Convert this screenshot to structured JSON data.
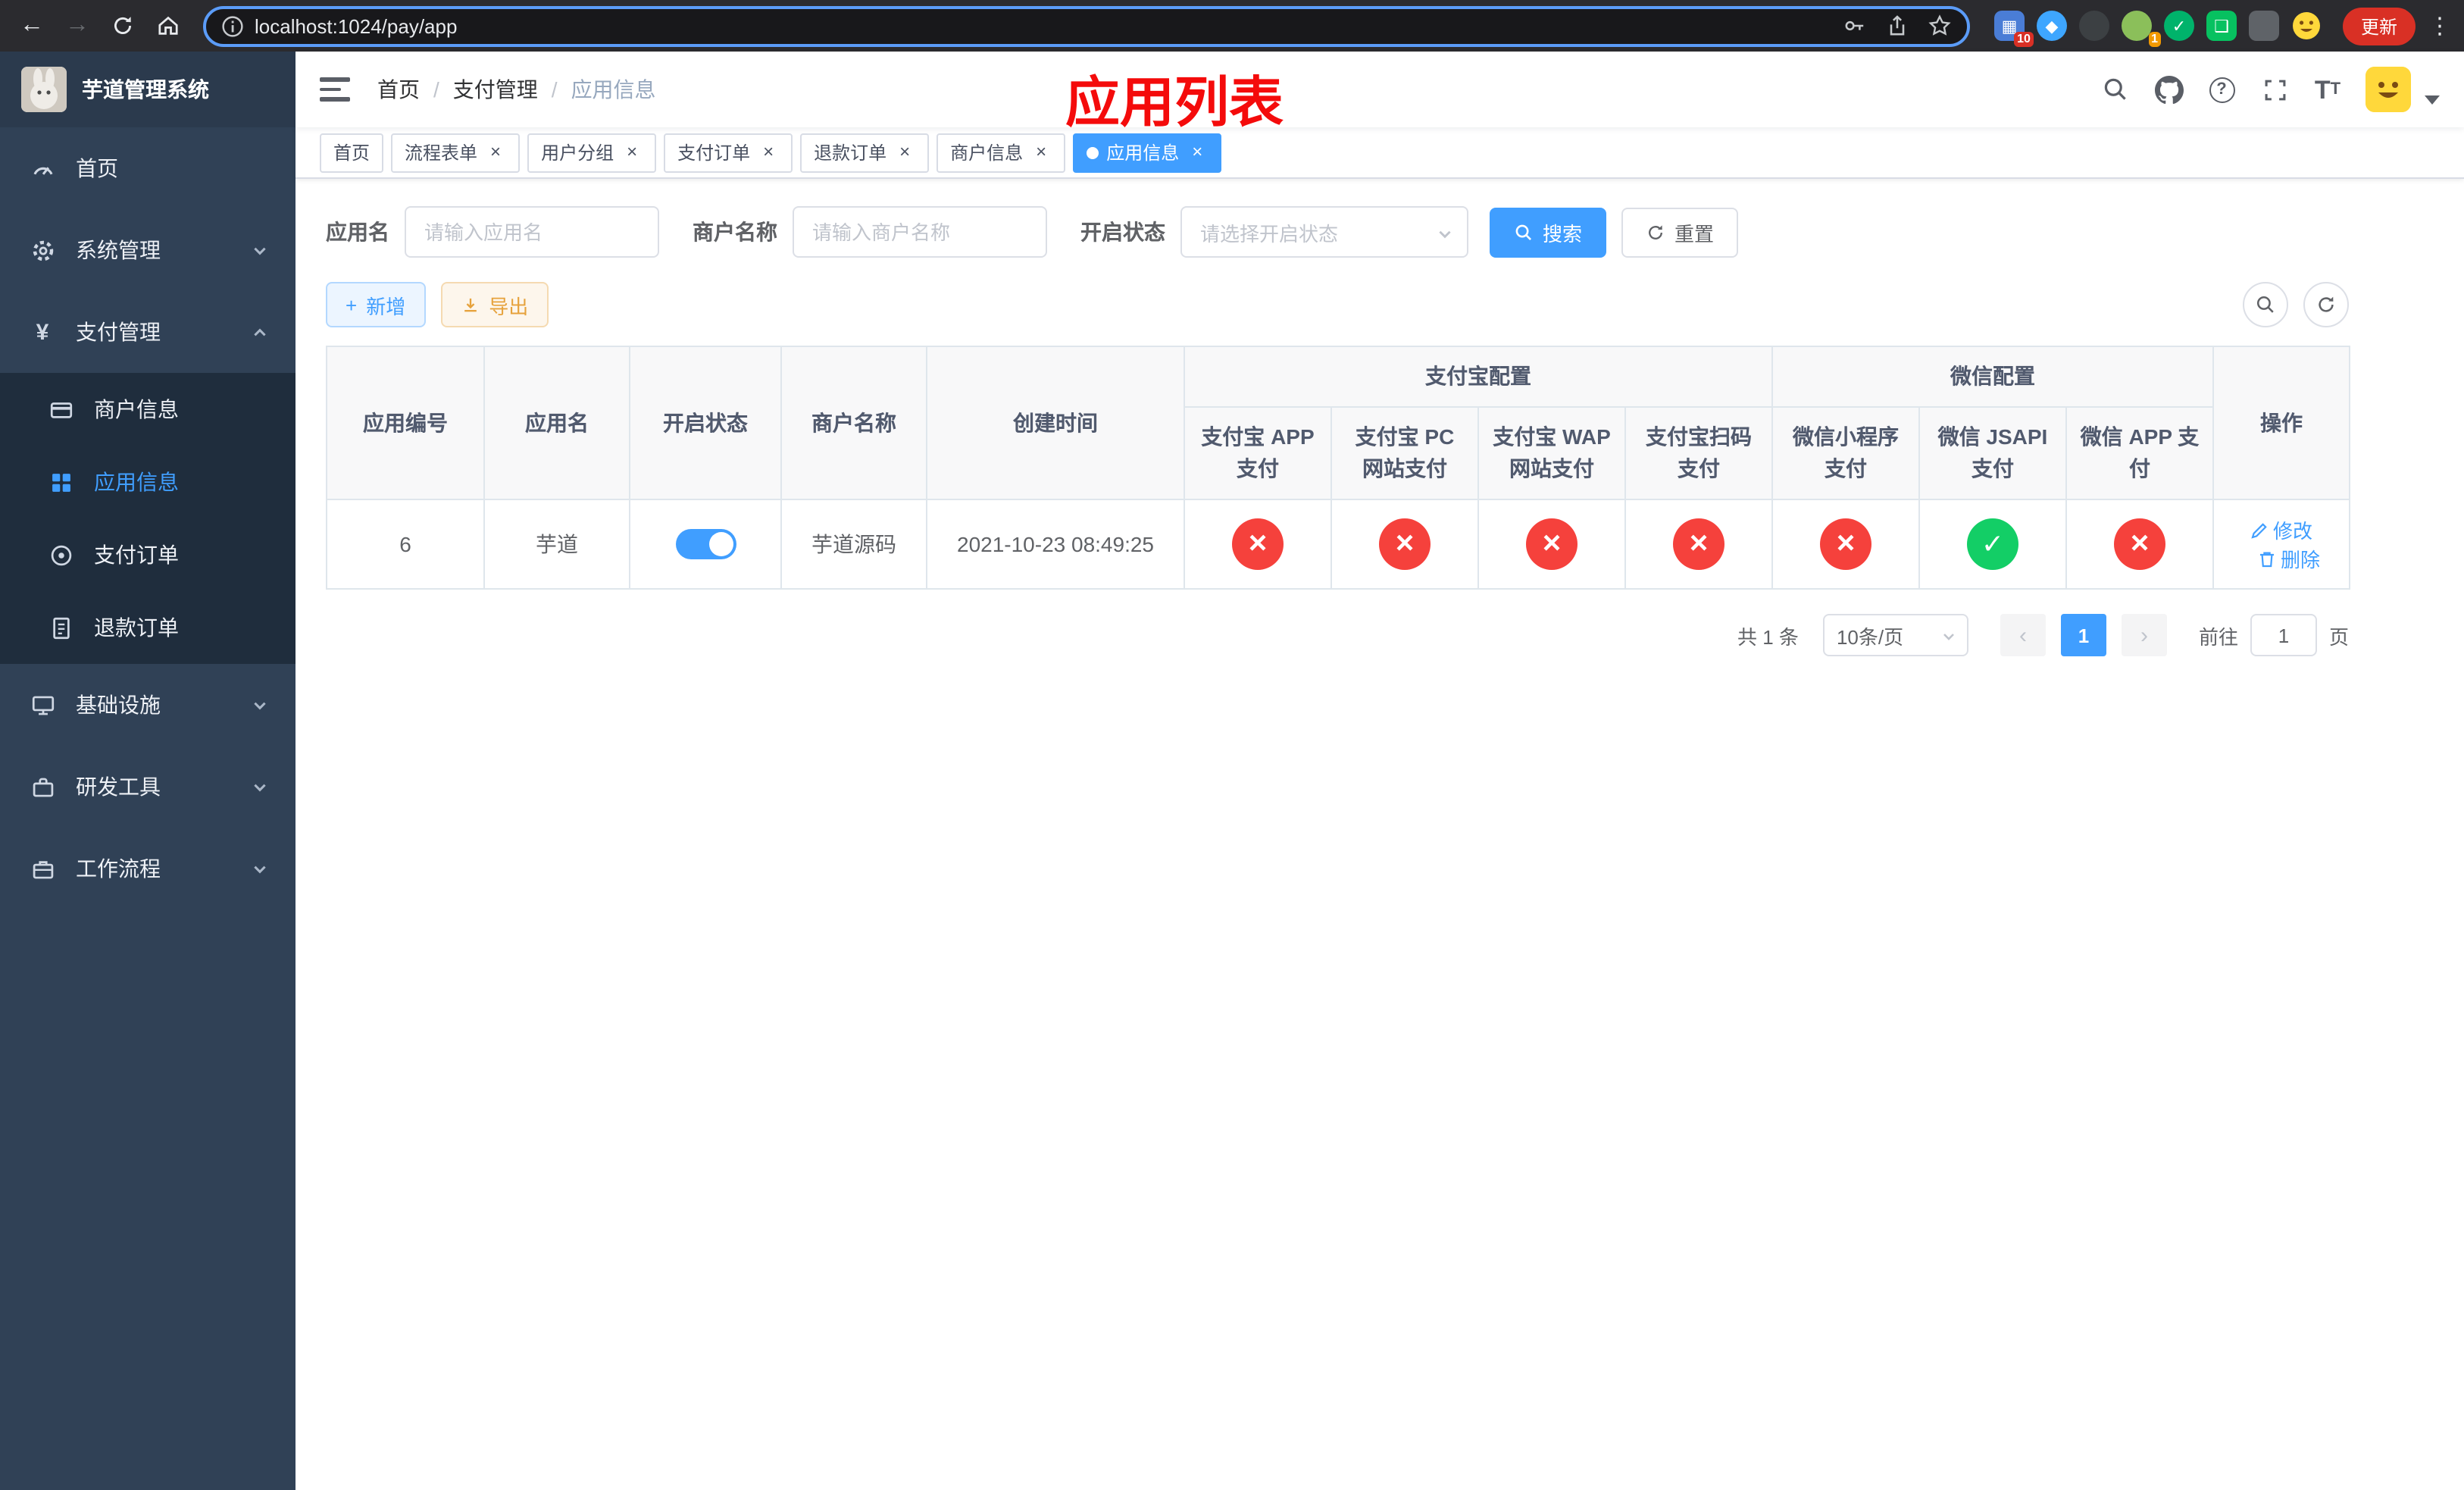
{
  "browser": {
    "url": "localhost:1024/pay/app",
    "update_label": "更新",
    "badge_pin": "10",
    "badge_avatar": "1"
  },
  "sidebar": {
    "title": "芋道管理系统",
    "home": "首页",
    "system": "系统管理",
    "payment": "支付管理",
    "merchant_info": "商户信息",
    "app_info": "应用信息",
    "pay_order": "支付订单",
    "refund_order": "退款订单",
    "infra": "基础设施",
    "dev_tools": "研发工具",
    "workflow": "工作流程"
  },
  "header": {
    "crumb_home": "首页",
    "crumb_pay": "支付管理",
    "crumb_app": "应用信息",
    "sep": "/",
    "overlay_title": "应用列表"
  },
  "tabs": [
    "首页",
    "流程表单",
    "用户分组",
    "支付订单",
    "退款订单",
    "商户信息",
    "应用信息"
  ],
  "filters": {
    "app_name_label": "应用名",
    "app_name_placeholder": "请输入应用名",
    "merchant_label": "商户名称",
    "merchant_placeholder": "请输入商户名称",
    "status_label": "开启状态",
    "status_placeholder": "请选择开启状态",
    "search_label": "搜索",
    "reset_label": "重置"
  },
  "toolbar": {
    "add_label": "新增",
    "export_label": "导出"
  },
  "table": {
    "group_alipay": "支付宝配置",
    "group_wechat": "微信配置",
    "col_id": "应用编号",
    "col_name": "应用名",
    "col_status": "开启状态",
    "col_merchant": "商户名称",
    "col_created": "创建时间",
    "col_ops": "操作",
    "sub_cols": [
      "支付宝 APP 支付",
      "支付宝 PC 网站支付",
      "支付宝 WAP 网站支付",
      "支付宝扫码支付",
      "微信小程序支付",
      "微信 JSAPI 支付",
      "微信 APP 支付"
    ],
    "row": {
      "id": "6",
      "name": "芋道",
      "enabled": true,
      "merchant": "芋道源码",
      "created": "2021-10-23 08:49:25",
      "channels": [
        "disabled",
        "disabled",
        "disabled",
        "disabled",
        "disabled",
        "enabled",
        "disabled"
      ],
      "edit_label": "修改",
      "delete_label": "删除"
    }
  },
  "pagination": {
    "total": "共 1 条",
    "page_size": "10条/页",
    "prev": "‹",
    "next": "›",
    "current": "1",
    "goto_prefix": "前往",
    "goto_value": "1",
    "goto_suffix": "页"
  },
  "glyphs": {
    "close": "×",
    "cross": "×",
    "check": "✓",
    "yen": "¥",
    "back": "←",
    "forward": "→",
    "plus": "+",
    "kebab": "⋮"
  },
  "colors": {
    "primary": "#409eff",
    "danger_circle": "#f5413c",
    "success_circle": "#13ce66",
    "sidebar_bg": "#304156",
    "submenu_bg": "#1f2d3d",
    "annotation_red": "#f40b0b"
  }
}
